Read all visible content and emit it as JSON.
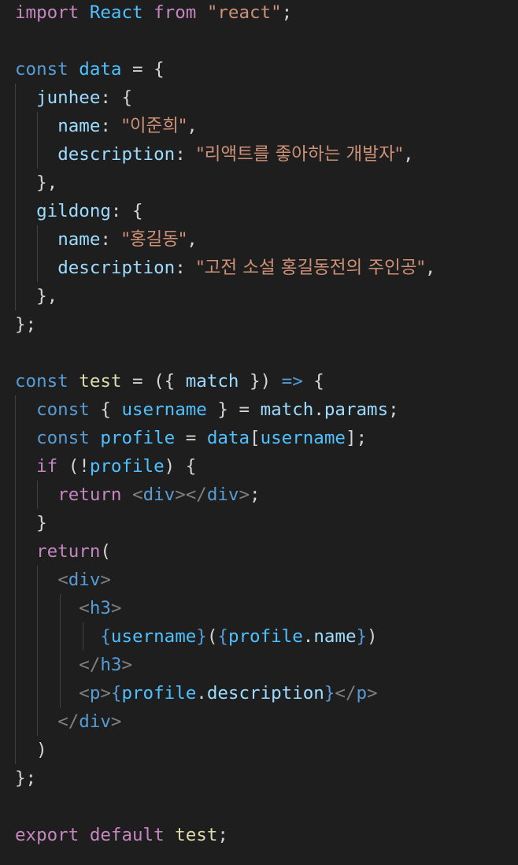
{
  "editor": {
    "theme": "dark",
    "background": "#1e1e1e",
    "tokens": {
      "import": "import",
      "react": "React",
      "from": "from",
      "react_str": "\"react\"",
      "const": "const",
      "data": "data",
      "junhee": "junhee",
      "gildong": "gildong",
      "name": "name",
      "description": "description",
      "junhee_name": "\"이준희\"",
      "junhee_desc": "\"리액트를 좋아하는 개발자\"",
      "gildong_name": "\"홍길동\"",
      "gildong_desc": "\"고전 소설 홍길동전의 주인공\"",
      "test": "test",
      "match": "match",
      "arrow": "=>",
      "username": "username",
      "params": "params",
      "profile": "profile",
      "if": "if",
      "return": "return",
      "div": "div",
      "h3": "h3",
      "p": "p",
      "export": "export",
      "default": "default"
    }
  }
}
